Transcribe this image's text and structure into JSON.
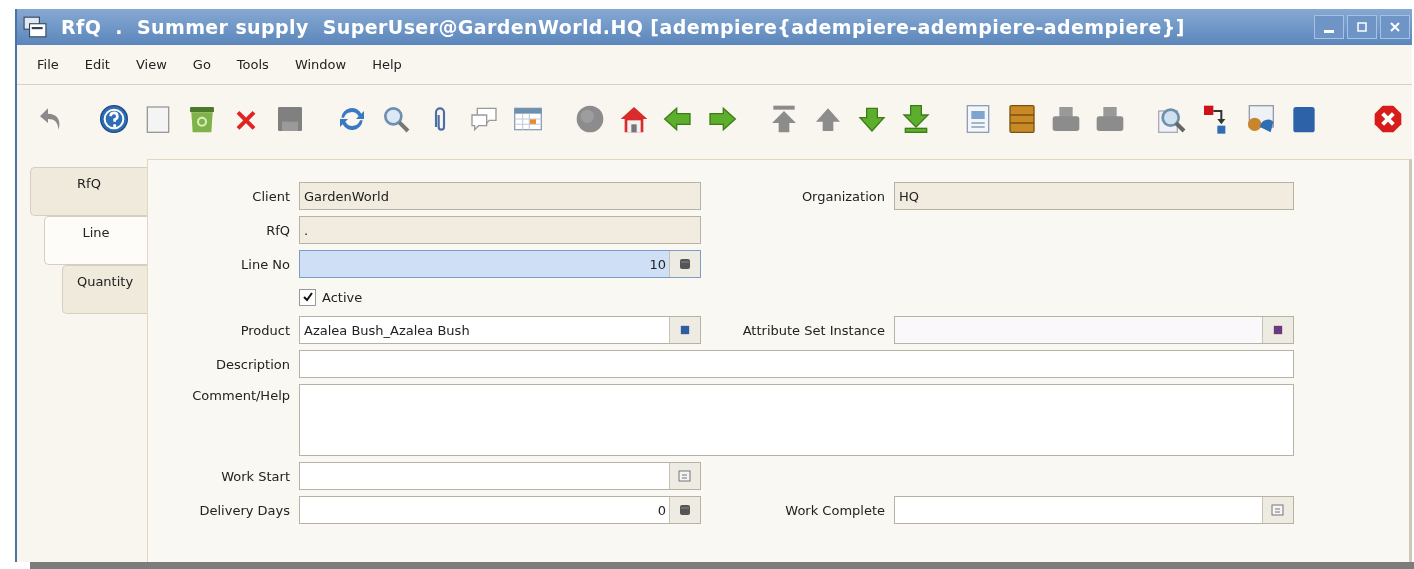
{
  "window": {
    "title": "RfQ  .  Summer supply  SuperUser@GardenWorld.HQ [adempiere{adempiere-adempiere-adempiere}]"
  },
  "menu": [
    "File",
    "Edit",
    "View",
    "Go",
    "Tools",
    "Window",
    "Help"
  ],
  "tabs": [
    {
      "label": "RfQ",
      "selected": false
    },
    {
      "label": "Line",
      "selected": true
    },
    {
      "label": "Quantity",
      "selected": false
    }
  ],
  "rows": [
    {
      "left": {
        "label": "Client",
        "kind": "text",
        "value": "GardenWorld",
        "readonly": true,
        "focused": false
      },
      "right": {
        "label": "Organization",
        "kind": "text",
        "value": "HQ",
        "readonly": true,
        "focused": false
      }
    },
    {
      "left": {
        "label": "RfQ",
        "kind": "text",
        "value": ".",
        "readonly": true,
        "focused": false
      }
    },
    {
      "left": {
        "label": "Line No",
        "kind": "number",
        "value": "10",
        "readonly": false,
        "focused": true
      }
    },
    {
      "left": {
        "label": "Active",
        "kind": "checkbox",
        "checked": true
      }
    },
    {
      "left": {
        "label": "Product",
        "kind": "search",
        "value": "Azalea Bush_Azalea Bush",
        "readonly": false,
        "focused": false
      },
      "right": {
        "label": "Attribute Set Instance",
        "kind": "attribute",
        "readonly": false,
        "focused": false
      }
    },
    {
      "wide": {
        "label": "Description",
        "kind": "text",
        "readonly": false,
        "focused": false
      }
    },
    {
      "wide": {
        "label": "Comment/Help",
        "kind": "textarea",
        "readonly": false,
        "focused": false
      }
    },
    {
      "left": {
        "label": "Work Start",
        "kind": "date",
        "readonly": false,
        "focused": false
      }
    },
    {
      "left": {
        "label": "Delivery Days",
        "kind": "number",
        "value": "0",
        "readonly": false,
        "focused": false
      },
      "right": {
        "label": "Work Complete",
        "kind": "date",
        "readonly": false,
        "focused": false
      }
    }
  ]
}
